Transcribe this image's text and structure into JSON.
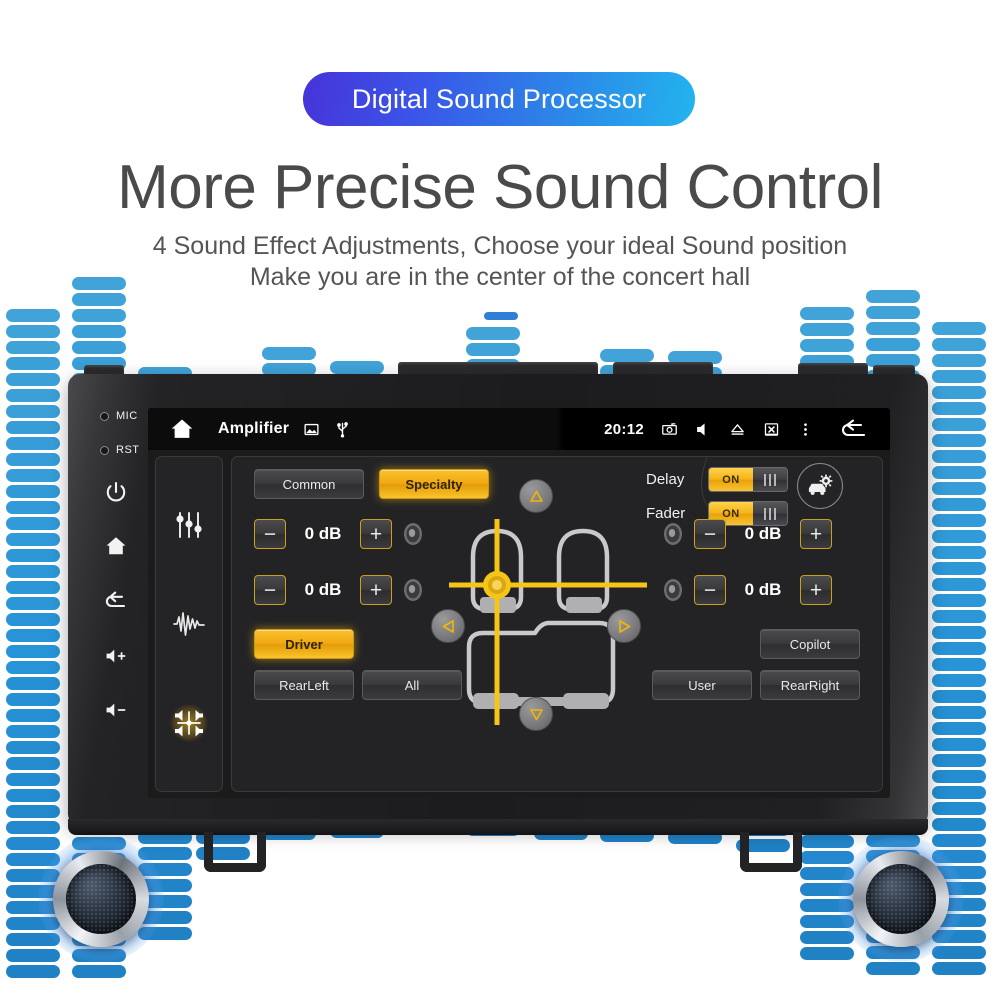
{
  "header": {
    "badge": "Digital Sound Processor",
    "headline": "More Precise Sound Control",
    "sub_line_1": "4 Sound Effect Adjustments, Choose your ideal Sound position",
    "sub_line_2": "Make you are in the center of the concert hall",
    "badge_gradient_from": "#4733d8",
    "badge_gradient_to": "#23b4ef"
  },
  "device": {
    "bezel": {
      "leds": [
        {
          "label": "MIC",
          "name": "mic-led"
        },
        {
          "label": "RST",
          "name": "reset-led"
        }
      ],
      "buttons": [
        {
          "name": "power-button",
          "icon": "power-icon"
        },
        {
          "name": "home-button",
          "icon": "home-icon"
        },
        {
          "name": "back-button",
          "icon": "back-arrow-icon"
        },
        {
          "name": "volume-up-button",
          "icon": "volume-up-icon"
        },
        {
          "name": "volume-down-button",
          "icon": "volume-down-icon"
        }
      ]
    }
  },
  "statusbar": {
    "home_icon": "home-icon",
    "title": "Amplifier",
    "left_icons": [
      "image-icon",
      "usb-icon"
    ],
    "time": "20:12",
    "right_icons": [
      "camera-icon",
      "mute-speaker-icon",
      "eject-icon",
      "sdcard-off-icon",
      "overflow-menu-icon"
    ],
    "back_icon": "back-arrow-icon"
  },
  "sidebar": {
    "items": [
      {
        "name": "equalizer-tab",
        "icon": "sliders-icon",
        "active": false
      },
      {
        "name": "sound-effect-tab",
        "icon": "waveform-icon",
        "active": false
      },
      {
        "name": "balance-fader-tab",
        "icon": "balance-speakers-icon",
        "active": true
      }
    ]
  },
  "main": {
    "modes": [
      {
        "label": "Common",
        "active": false
      },
      {
        "label": "Specialty",
        "active": true
      }
    ],
    "toggles": [
      {
        "label": "Delay",
        "state": "ON"
      },
      {
        "label": "Fader",
        "state": "ON"
      }
    ],
    "car_settings_button": "car-settings-icon",
    "levels": [
      {
        "name": "front-left-level",
        "value": "0 dB",
        "minus": "−",
        "plus": "+"
      },
      {
        "name": "rear-left-level",
        "value": "0 dB",
        "minus": "−",
        "plus": "+"
      },
      {
        "name": "front-right-level",
        "value": "0 dB",
        "minus": "−",
        "plus": "+"
      },
      {
        "name": "rear-right-level",
        "value": "0 dB",
        "minus": "−",
        "plus": "+"
      }
    ],
    "presets": [
      {
        "label": "Driver",
        "active": true
      },
      {
        "label": "RearLeft",
        "active": false
      },
      {
        "label": "All",
        "active": false
      },
      {
        "label": "User",
        "active": false
      },
      {
        "label": "Copilot",
        "active": false
      },
      {
        "label": "RearRight",
        "active": false
      }
    ],
    "nav": [
      {
        "name": "position-up-button",
        "icon": "triangle-up-icon"
      },
      {
        "name": "position-down-button",
        "icon": "triangle-down-icon"
      },
      {
        "name": "position-left-button",
        "icon": "triangle-left-icon"
      },
      {
        "name": "position-right-button",
        "icon": "triangle-right-icon"
      }
    ],
    "accent_color": "#f4b214",
    "crosshair_color": "#f5c518"
  },
  "speakers": [
    {
      "name": "speaker-left"
    },
    {
      "name": "speaker-right"
    }
  ]
}
